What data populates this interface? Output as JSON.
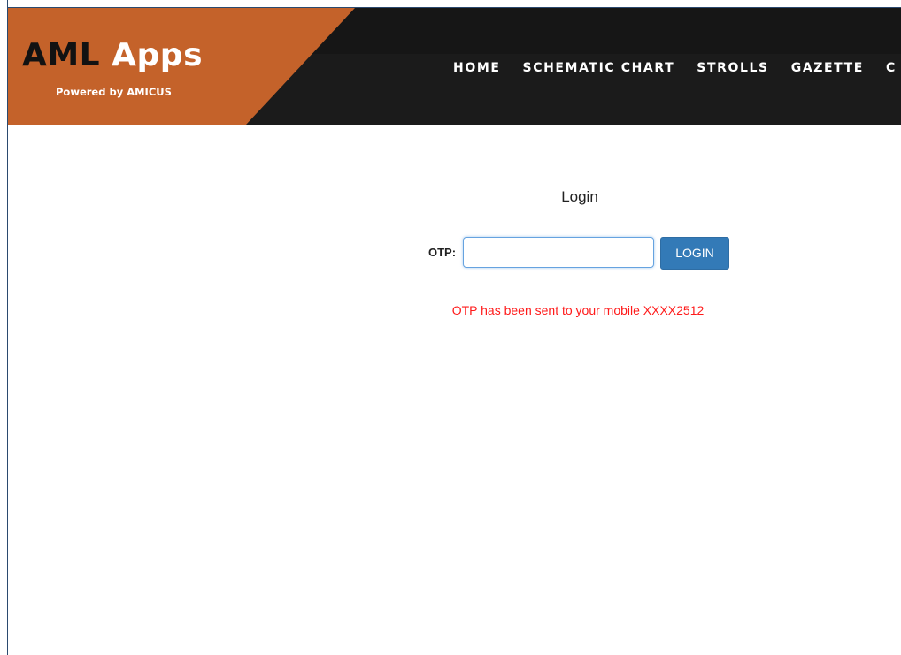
{
  "header": {
    "brand_title_part1": "AML ",
    "brand_title_part2": "Apps",
    "brand_subtitle": "Powered by AMICUS",
    "brand_color": "#c4622a",
    "background_color": "#1b1b1b"
  },
  "nav": {
    "items": [
      {
        "label": "HOME"
      },
      {
        "label": "SCHEMATIC CHART"
      },
      {
        "label": "STROLLS"
      },
      {
        "label": "GAZETTE"
      },
      {
        "label": "C"
      }
    ]
  },
  "login": {
    "title": "Login",
    "otp_label": "OTP:",
    "otp_value": "",
    "otp_placeholder": "",
    "button_label": "LOGIN",
    "button_color": "#337ab7",
    "message": "OTP has been sent to your mobile XXXX2512",
    "message_color": "#ff1a1a"
  }
}
